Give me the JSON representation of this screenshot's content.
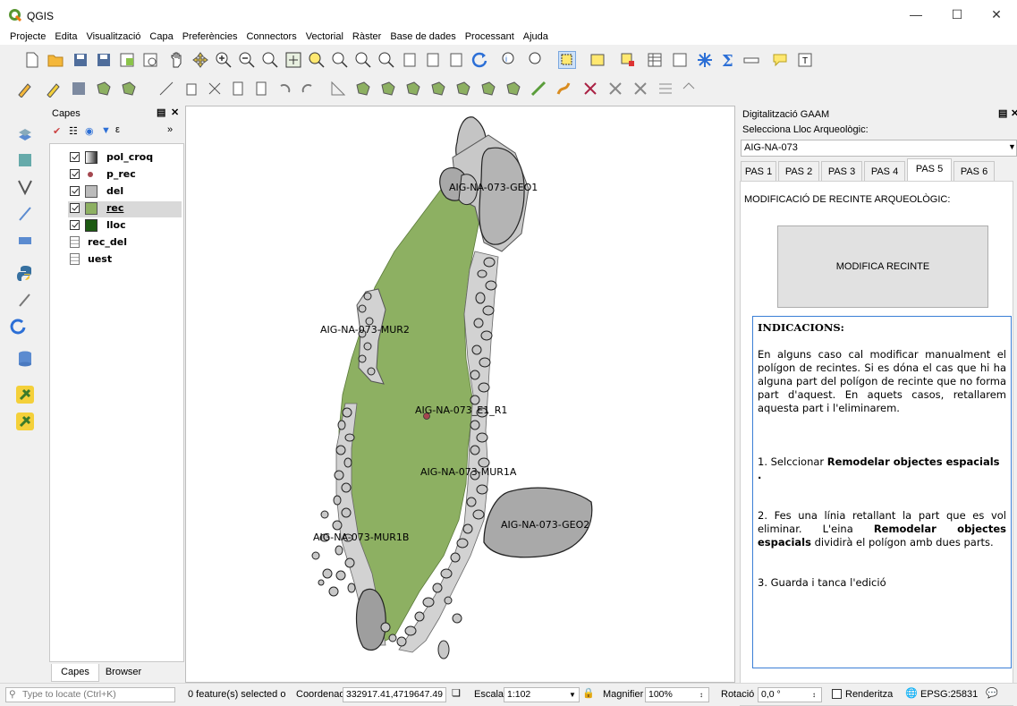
{
  "window": {
    "title": "QGIS"
  },
  "menubar": [
    "Projecte",
    "Edita",
    "Visualització",
    "Capa",
    "Preferències",
    "Connectors",
    "Vectorial",
    "Ràster",
    "Base de dades",
    "Processant",
    "Ajuda"
  ],
  "layers_panel": {
    "title": "Capes",
    "layers": [
      {
        "name": "pol_croq",
        "checked": true,
        "symbol": "gradient"
      },
      {
        "name": "p_rec",
        "checked": true,
        "symbol": "point"
      },
      {
        "name": "del",
        "checked": true,
        "symbol": "grey-fill"
      },
      {
        "name": "rec",
        "checked": true,
        "symbol": "edit-green"
      },
      {
        "name": "lloc",
        "checked": true,
        "symbol": "dark-green"
      },
      {
        "name": "rec_del",
        "checked": false,
        "symbol": "table"
      },
      {
        "name": "uest",
        "checked": false,
        "symbol": "table"
      }
    ],
    "tabs": [
      "Capes",
      "Browser"
    ]
  },
  "map": {
    "labels": [
      "AIG-NA-073-GEO1",
      "AIG-NA-073-MUR2",
      "AIG-NA-073_E1_R1",
      "AIG-NA-073-MUR1A",
      "AIG-NA-073-GEO2",
      "AIG-NA-073-MUR1B"
    ],
    "colors": {
      "polygon": "#8db062",
      "stone": "#c4c4c4",
      "stone_dark": "#9a9a9a"
    }
  },
  "right_panel": {
    "title": "Digitalització GAAM",
    "select_label": "Selecciona Lloc Arqueològic:",
    "select_value": "AIG-NA-073",
    "tabs": [
      "PAS 1",
      "PAS 2",
      "PAS 3",
      "PAS 4",
      "PAS 5",
      "PAS 6"
    ],
    "active_tab": "PAS 5",
    "heading": "MODIFICACIÓ DE RECINTE ARQUEOLÒGIC:",
    "button": "MODIFICA RECINTE",
    "indicacions_title": "INDICACIONS:",
    "para1": "En alguns caso cal modificar manualment el polígon de recintes. Si es dóna el cas que hi ha alguna part del polígon de recinte que no forma part d'aquest. En aquets casos, retallarem aquesta part i l'eliminarem.",
    "step1_pre": "1. Selccionar ",
    "step1_bold": "Remodelar objectes espacials .",
    "step2_pre": "2. Fes una línia retallant la part que es vol eliminar. L'eina ",
    "step2_bold": "Remodelar objectes espacials",
    "step2_post": " dividirà el polígon amb dues parts.",
    "step3": "3. Guarda i tanca l'edició"
  },
  "statusbar": {
    "locate_placeholder": "Type to locate (Ctrl+K)",
    "selected": "0 feature(s) selected o",
    "coord_label": "Coordenada",
    "coord_value": "332917.41,4719647.49",
    "scale_label": "Escala",
    "scale_value": "1:102",
    "magnifier_label": "Magnifier",
    "magnifier_value": "100%",
    "rotation_label": "Rotació",
    "rotation_value": "0,0 °",
    "render_label": "Renderitza",
    "crs": "EPSG:25831"
  }
}
